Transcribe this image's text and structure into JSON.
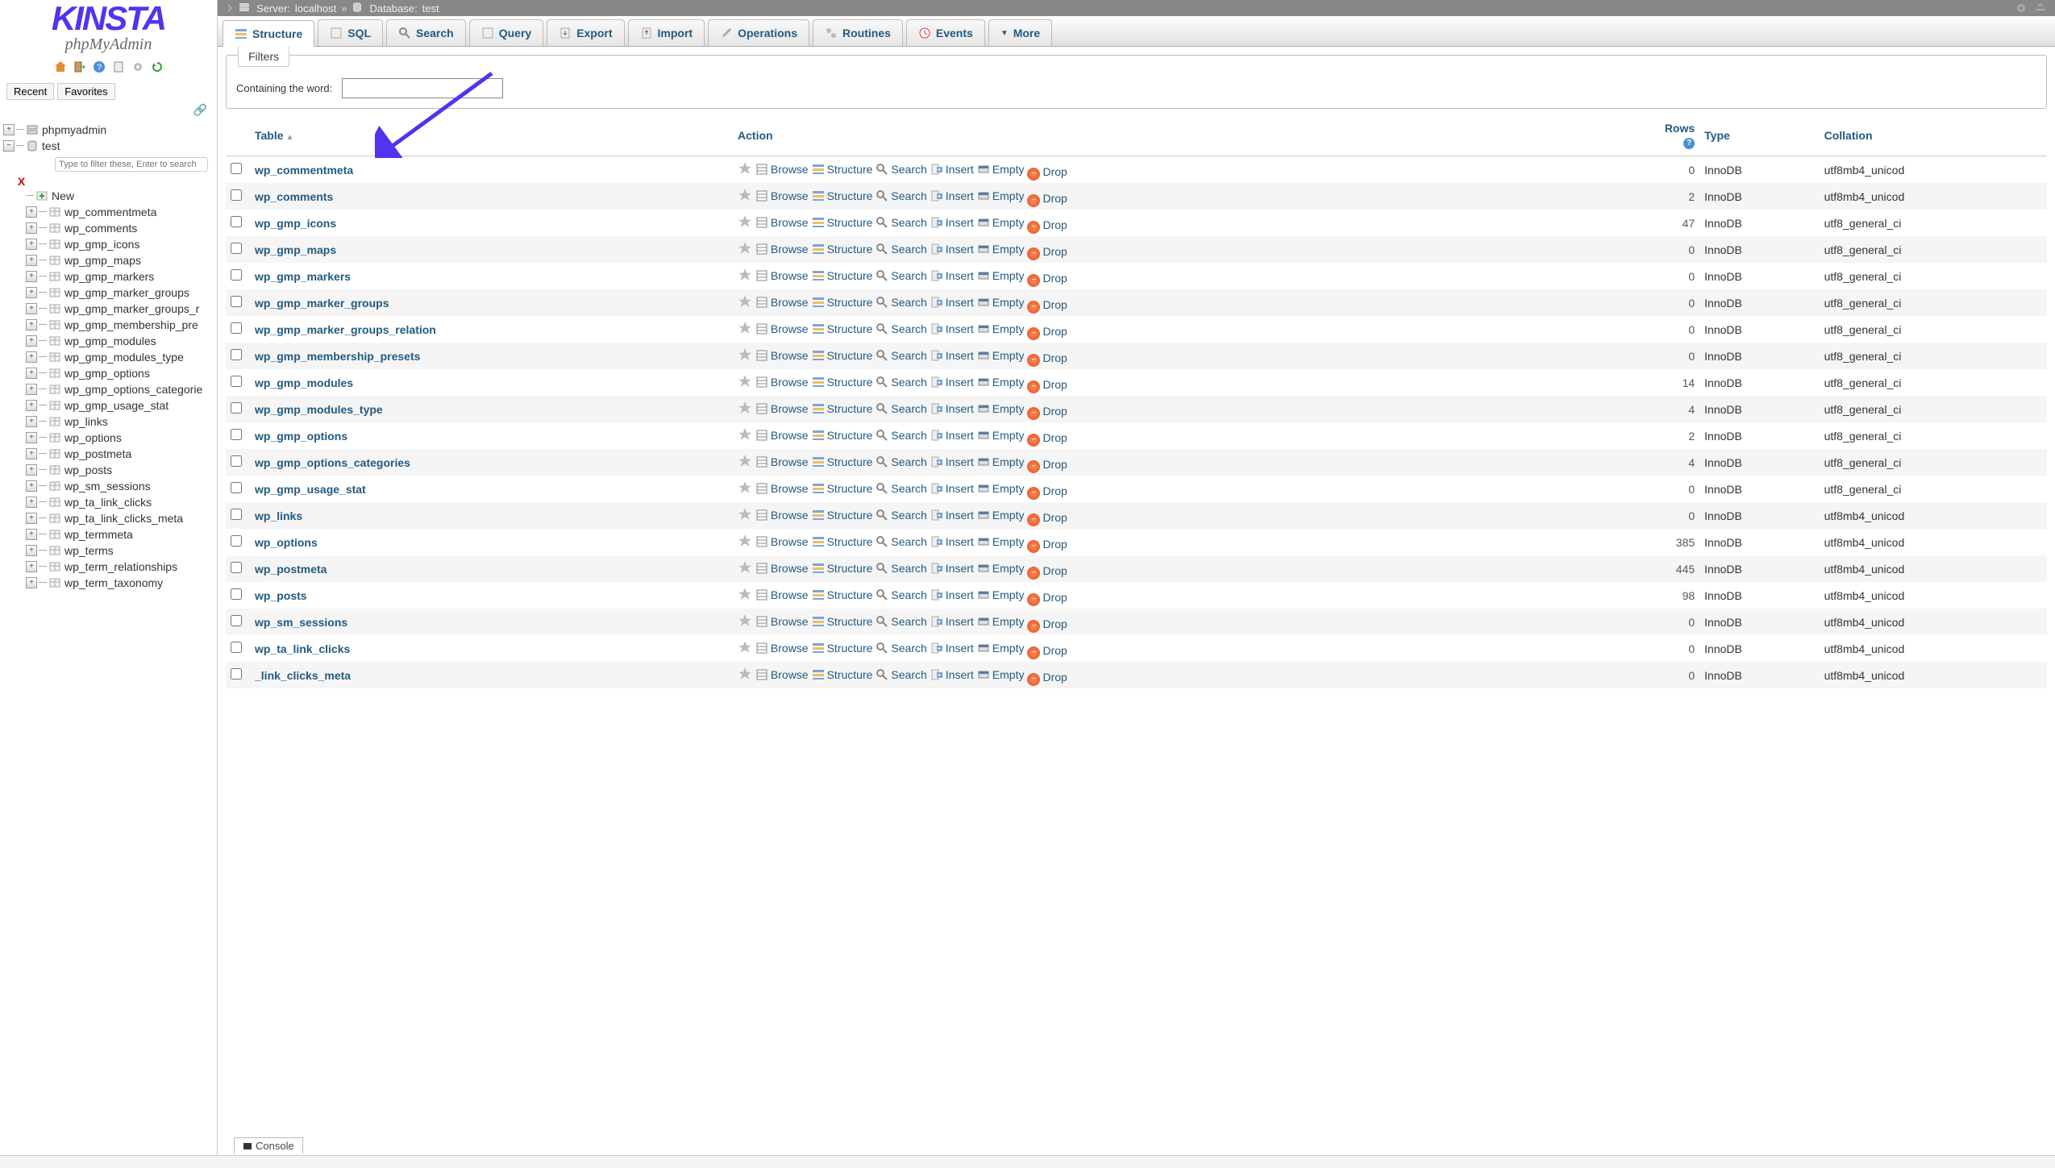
{
  "logo": {
    "brand": "KINSTA",
    "sub": "phpMyAdmin"
  },
  "sidebar": {
    "recent": "Recent",
    "favorites": "Favorites",
    "root": "phpmyadmin",
    "db": "test",
    "filter_placeholder": "Type to filter these, Enter to search",
    "new_label": "New",
    "tables": [
      "wp_commentmeta",
      "wp_comments",
      "wp_gmp_icons",
      "wp_gmp_maps",
      "wp_gmp_markers",
      "wp_gmp_marker_groups",
      "wp_gmp_marker_groups_r",
      "wp_gmp_membership_pre",
      "wp_gmp_modules",
      "wp_gmp_modules_type",
      "wp_gmp_options",
      "wp_gmp_options_categorie",
      "wp_gmp_usage_stat",
      "wp_links",
      "wp_options",
      "wp_postmeta",
      "wp_posts",
      "wp_sm_sessions",
      "wp_ta_link_clicks",
      "wp_ta_link_clicks_meta",
      "wp_termmeta",
      "wp_terms",
      "wp_term_relationships",
      "wp_term_taxonomy"
    ]
  },
  "breadcrumb": {
    "server_label": "Server:",
    "server_value": "localhost",
    "db_label": "Database:",
    "db_value": "test"
  },
  "tabs": {
    "structure": "Structure",
    "sql": "SQL",
    "search": "Search",
    "query": "Query",
    "export": "Export",
    "import": "Import",
    "operations": "Operations",
    "routines": "Routines",
    "events": "Events",
    "more": "More"
  },
  "filters": {
    "legend": "Filters",
    "label": "Containing the word:"
  },
  "headers": {
    "table": "Table",
    "action": "Action",
    "rows": "Rows",
    "type": "Type",
    "collation": "Collation"
  },
  "actions": {
    "browse": "Browse",
    "structure": "Structure",
    "search": "Search",
    "insert": "Insert",
    "empty": "Empty",
    "drop": "Drop"
  },
  "rows_info_char": "?",
  "console": "Console",
  "tables": [
    {
      "name": "wp_commentmeta",
      "rows": 0,
      "type": "InnoDB",
      "collation": "utf8mb4_unicod"
    },
    {
      "name": "wp_comments",
      "rows": 2,
      "type": "InnoDB",
      "collation": "utf8mb4_unicod"
    },
    {
      "name": "wp_gmp_icons",
      "rows": 47,
      "type": "InnoDB",
      "collation": "utf8_general_ci"
    },
    {
      "name": "wp_gmp_maps",
      "rows": 0,
      "type": "InnoDB",
      "collation": "utf8_general_ci"
    },
    {
      "name": "wp_gmp_markers",
      "rows": 0,
      "type": "InnoDB",
      "collation": "utf8_general_ci"
    },
    {
      "name": "wp_gmp_marker_groups",
      "rows": 0,
      "type": "InnoDB",
      "collation": "utf8_general_ci"
    },
    {
      "name": "wp_gmp_marker_groups_relation",
      "rows": 0,
      "type": "InnoDB",
      "collation": "utf8_general_ci"
    },
    {
      "name": "wp_gmp_membership_presets",
      "rows": 0,
      "type": "InnoDB",
      "collation": "utf8_general_ci"
    },
    {
      "name": "wp_gmp_modules",
      "rows": 14,
      "type": "InnoDB",
      "collation": "utf8_general_ci"
    },
    {
      "name": "wp_gmp_modules_type",
      "rows": 4,
      "type": "InnoDB",
      "collation": "utf8_general_ci"
    },
    {
      "name": "wp_gmp_options",
      "rows": 2,
      "type": "InnoDB",
      "collation": "utf8_general_ci"
    },
    {
      "name": "wp_gmp_options_categories",
      "rows": 4,
      "type": "InnoDB",
      "collation": "utf8_general_ci"
    },
    {
      "name": "wp_gmp_usage_stat",
      "rows": 0,
      "type": "InnoDB",
      "collation": "utf8_general_ci"
    },
    {
      "name": "wp_links",
      "rows": 0,
      "type": "InnoDB",
      "collation": "utf8mb4_unicod"
    },
    {
      "name": "wp_options",
      "rows": 385,
      "type": "InnoDB",
      "collation": "utf8mb4_unicod"
    },
    {
      "name": "wp_postmeta",
      "rows": 445,
      "type": "InnoDB",
      "collation": "utf8mb4_unicod"
    },
    {
      "name": "wp_posts",
      "rows": 98,
      "type": "InnoDB",
      "collation": "utf8mb4_unicod"
    },
    {
      "name": "wp_sm_sessions",
      "rows": 0,
      "type": "InnoDB",
      "collation": "utf8mb4_unicod"
    },
    {
      "name": "wp_ta_link_clicks",
      "rows": 0,
      "type": "InnoDB",
      "collation": "utf8mb4_unicod"
    },
    {
      "name": "_link_clicks_meta",
      "rows": 0,
      "type": "InnoDB",
      "collation": "utf8mb4_unicod"
    }
  ],
  "icons": {
    "home": "home-icon",
    "exit": "exit-icon",
    "help": "help-icon",
    "docs": "docs-icon",
    "gear": "gear-icon",
    "reload": "reload-icon",
    "server": "server-icon",
    "database": "database-icon",
    "table": "table-icon",
    "star": "star-icon",
    "browse": "browse-icon",
    "structure": "structure-icon",
    "search": "search-icon",
    "insert": "insert-icon",
    "empty": "empty-icon",
    "drop": "drop-icon",
    "link": "link-icon",
    "new": "new-icon"
  }
}
